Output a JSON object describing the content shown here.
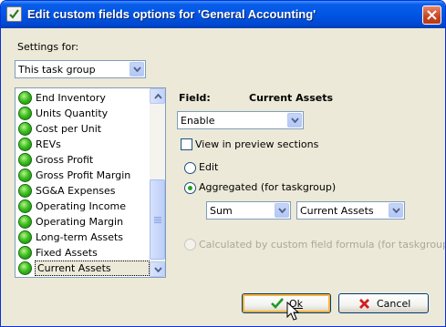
{
  "window": {
    "title": "Edit custom fields options for  'General Accounting'",
    "close_icon": "close-icon"
  },
  "settings": {
    "label": "Settings for:",
    "selected": "This task group"
  },
  "fields_list": {
    "items": [
      {
        "label": "End Inventory"
      },
      {
        "label": "Units Quantity"
      },
      {
        "label": "Cost per Unit"
      },
      {
        "label": "REVs"
      },
      {
        "label": "Gross Profit"
      },
      {
        "label": "Gross Profit Margin"
      },
      {
        "label": "SG&A Expenses"
      },
      {
        "label": "Operating Income"
      },
      {
        "label": "Operating Margin"
      },
      {
        "label": "Long-term Assets"
      },
      {
        "label": "Fixed Assets"
      },
      {
        "label": "Current Assets"
      }
    ],
    "selected_index": 11,
    "status_icon": "green-circle-icon"
  },
  "field_panel": {
    "field_label": "Field:",
    "field_name": "Current Assets",
    "state_selected": "Enable",
    "preview_label": "View in preview sections",
    "preview_checked": false,
    "edit_label": "Edit",
    "aggregated_label": "Aggregated (for taskgroup)",
    "aggregated_checked": true,
    "aggregate_function": "Sum",
    "aggregate_field": "Current Assets",
    "calculated_label": "Calculated by custom field formula (for taskgroup)",
    "calculated_enabled": false
  },
  "buttons": {
    "ok_label": "Ok",
    "cancel_label": "Cancel"
  },
  "colors": {
    "titlebar": "#0055e5",
    "dialog_bg": "#ece9d8",
    "status_green": "#3fbf22",
    "cancel_red": "#d21f1f",
    "ok_green": "#1e9a1e"
  }
}
